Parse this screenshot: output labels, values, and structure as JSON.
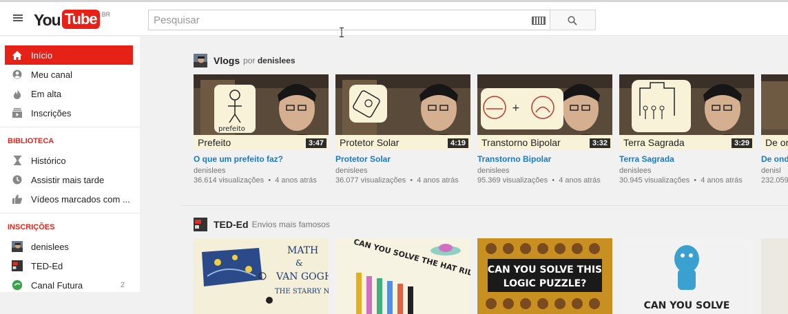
{
  "header": {
    "logo_you": "You",
    "logo_tube": "Tube",
    "logo_country": "BR",
    "search_placeholder": "Pesquisar"
  },
  "sidebar": {
    "main_items": [
      {
        "label": "Início",
        "icon": "home-icon"
      },
      {
        "label": "Meu canal",
        "icon": "person-icon"
      },
      {
        "label": "Em alta",
        "icon": "flame-icon"
      },
      {
        "label": "Inscrições",
        "icon": "subscriptions-icon"
      }
    ],
    "library_title": "BIBLIOTECA",
    "library_items": [
      {
        "label": "Histórico",
        "icon": "hourglass-icon"
      },
      {
        "label": "Assistir mais tarde",
        "icon": "clock-icon"
      },
      {
        "label": "Vídeos marcados com ...",
        "icon": "thumbs-up-icon"
      }
    ],
    "subs_title": "INSCRIÇÕES",
    "subs_items": [
      {
        "label": "denislees",
        "count": ""
      },
      {
        "label": "TED-Ed",
        "count": ""
      },
      {
        "label": "Canal Futura",
        "count": "2"
      }
    ]
  },
  "shelves": [
    {
      "title": "Vlogs",
      "sub_prefix": "por",
      "sub_channel": "denislees",
      "videos": [
        {
          "thumb_label": "Prefeito",
          "duration": "3:47",
          "title": "O que um prefeito faz?",
          "channel": "denislees",
          "views": "36.614 visualizações",
          "age": "4 anos atrás"
        },
        {
          "thumb_label": "Protetor Solar",
          "duration": "4:19",
          "title": "Protetor Solar",
          "channel": "denislees",
          "views": "36.077 visualizações",
          "age": "4 anos atrás"
        },
        {
          "thumb_label": "Transtorno Bipolar",
          "duration": "3:32",
          "title": "Transtorno Bipolar",
          "channel": "denislees",
          "views": "95.369 visualizações",
          "age": "4 anos atrás"
        },
        {
          "thumb_label": "Terra Sagrada",
          "duration": "3:29",
          "title": "Terra Sagrada",
          "channel": "denislees",
          "views": "30.945 visualizações",
          "age": "4 anos atrás"
        },
        {
          "thumb_label": "De ond",
          "duration": "",
          "title": "De ond",
          "channel": "denisl",
          "views": "232.059",
          "age": ""
        }
      ]
    },
    {
      "title": "TED-Ed",
      "sub_prefix": "Envios mais famosos",
      "sub_channel": "",
      "videos": [
        {
          "thumb_text": "MATH & VAN GOGH'S THE STARRY NIGHT"
        },
        {
          "thumb_text": "CAN YOU SOLVE THE HAT RIDDLE?"
        },
        {
          "thumb_text": "CAN YOU SOLVE THIS LOGIC PUZZLE?"
        },
        {
          "thumb_text": "CAN YOU SOLVE"
        },
        {
          "thumb_text": ""
        }
      ]
    }
  ]
}
